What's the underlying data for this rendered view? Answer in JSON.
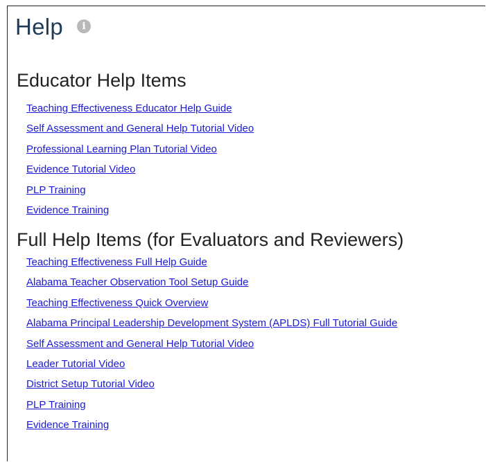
{
  "header": {
    "title": "Help",
    "info_icon": "info-icon"
  },
  "sections": [
    {
      "title": "Educator Help Items",
      "links": [
        "Teaching Effectiveness Educator Help Guide",
        "Self Assessment and General Help Tutorial Video",
        "Professional Learning Plan Tutorial Video",
        "Evidence Tutorial Video",
        "PLP Training",
        "Evidence Training"
      ]
    },
    {
      "title": "Full Help Items (for Evaluators and Reviewers)",
      "links": [
        "Teaching Effectiveness Full Help Guide",
        "Alabama Teacher Observation Tool Setup Guide",
        "Teaching Effectiveness Quick Overview",
        "Alabama Principal Leadership Development System (APLDS) Full Tutorial Guide",
        "Self Assessment and General Help Tutorial Video",
        "Leader Tutorial Video",
        "District Setup Tutorial Video",
        "PLP Training",
        "Evidence Training"
      ]
    }
  ],
  "colors": {
    "title": "#1f3b57",
    "link": "#1a1ad6",
    "info_icon_bg": "#b9b9b9"
  }
}
